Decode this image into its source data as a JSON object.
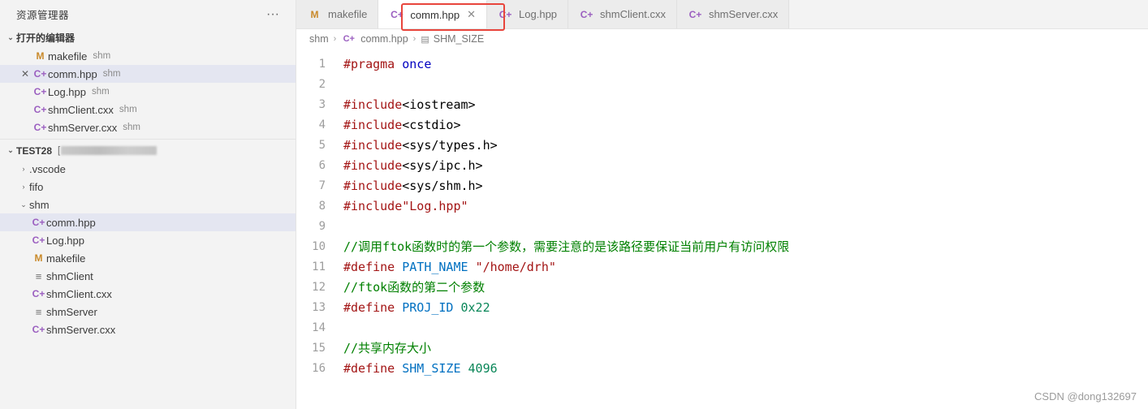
{
  "sidebar": {
    "title": "资源管理器",
    "more_icon": "ellipsis-icon",
    "open_editors": {
      "label": "打开的编辑器",
      "caret": "⌄",
      "items": [
        {
          "name": "makefile",
          "sub": "shm",
          "icon": "M",
          "icon_kind": "m",
          "closable": false,
          "selected": false
        },
        {
          "name": "comm.hpp",
          "sub": "shm",
          "icon": "C+",
          "icon_kind": "cpp",
          "closable": true,
          "selected": true
        },
        {
          "name": "Log.hpp",
          "sub": "shm",
          "icon": "C+",
          "icon_kind": "cpp",
          "closable": false,
          "selected": false
        },
        {
          "name": "shmClient.cxx",
          "sub": "shm",
          "icon": "C+",
          "icon_kind": "cpp",
          "closable": false,
          "selected": false
        },
        {
          "name": "shmServer.cxx",
          "sub": "shm",
          "icon": "C+",
          "icon_kind": "cpp",
          "closable": false,
          "selected": false
        }
      ]
    },
    "workspace": {
      "label": "TEST28",
      "bracket_open": "[",
      "blurred": true,
      "caret": "⌄",
      "folders": [
        {
          "name": ".vscode",
          "caret": "›"
        },
        {
          "name": "fifo",
          "caret": "›"
        },
        {
          "name": "shm",
          "caret": "⌄"
        }
      ],
      "files": [
        {
          "name": "comm.hpp",
          "icon": "C+",
          "icon_kind": "cpp",
          "selected": true
        },
        {
          "name": "Log.hpp",
          "icon": "C+",
          "icon_kind": "cpp",
          "selected": false
        },
        {
          "name": "makefile",
          "icon": "M",
          "icon_kind": "m",
          "selected": false
        },
        {
          "name": "shmClient",
          "icon": "≡",
          "icon_kind": "plain",
          "selected": false
        },
        {
          "name": "shmClient.cxx",
          "icon": "C+",
          "icon_kind": "cpp",
          "selected": false
        },
        {
          "name": "shmServer",
          "icon": "≡",
          "icon_kind": "plain",
          "selected": false
        },
        {
          "name": "shmServer.cxx",
          "icon": "C+",
          "icon_kind": "cpp",
          "selected": false
        }
      ]
    }
  },
  "tabs": [
    {
      "label": "makefile",
      "icon": "M",
      "icon_kind": "m",
      "active": false,
      "close": ""
    },
    {
      "label": "comm.hpp",
      "icon": "C+",
      "icon_kind": "cpp",
      "active": true,
      "close": "✕",
      "highlighted": true
    },
    {
      "label": "Log.hpp",
      "icon": "C+",
      "icon_kind": "cpp",
      "active": false,
      "close": ""
    },
    {
      "label": "shmClient.cxx",
      "icon": "C+",
      "icon_kind": "cpp",
      "active": false,
      "close": ""
    },
    {
      "label": "shmServer.cxx",
      "icon": "C+",
      "icon_kind": "cpp",
      "active": false,
      "close": ""
    }
  ],
  "breadcrumb": [
    {
      "label": "shm",
      "icon": ""
    },
    {
      "label": "comm.hpp",
      "icon": "C+"
    },
    {
      "label": "SHM_SIZE",
      "icon": "▤"
    }
  ],
  "code": {
    "lines": [
      {
        "n": "1",
        "parts": [
          {
            "t": "#pragma",
            "c": "k-pre"
          },
          {
            "t": " ",
            "c": ""
          },
          {
            "t": "once",
            "c": "k-dir"
          }
        ]
      },
      {
        "n": "2",
        "parts": []
      },
      {
        "n": "3",
        "parts": [
          {
            "t": "#include",
            "c": "k-pre"
          },
          {
            "t": "<iostream>",
            "c": "code-text"
          }
        ]
      },
      {
        "n": "4",
        "parts": [
          {
            "t": "#include",
            "c": "k-pre"
          },
          {
            "t": "<cstdio>",
            "c": "code-text"
          }
        ]
      },
      {
        "n": "5",
        "parts": [
          {
            "t": "#include",
            "c": "k-pre"
          },
          {
            "t": "<sys/types.h>",
            "c": "code-text"
          }
        ]
      },
      {
        "n": "6",
        "parts": [
          {
            "t": "#include",
            "c": "k-pre"
          },
          {
            "t": "<sys/ipc.h>",
            "c": "code-text"
          }
        ]
      },
      {
        "n": "7",
        "parts": [
          {
            "t": "#include",
            "c": "k-pre"
          },
          {
            "t": "<sys/shm.h>",
            "c": "code-text"
          }
        ]
      },
      {
        "n": "8",
        "parts": [
          {
            "t": "#include",
            "c": "k-pre"
          },
          {
            "t": "\"Log.hpp\"",
            "c": "k-str"
          }
        ]
      },
      {
        "n": "9",
        "parts": []
      },
      {
        "n": "10",
        "parts": [
          {
            "t": "//调用ftok函数时的第一个参数，需要注意的是该路径要保证当前用户有访问权限",
            "c": "k-com"
          }
        ]
      },
      {
        "n": "11",
        "parts": [
          {
            "t": "#define",
            "c": "k-pre"
          },
          {
            "t": " ",
            "c": ""
          },
          {
            "t": "PATH_NAME",
            "c": "k-macro"
          },
          {
            "t": " ",
            "c": ""
          },
          {
            "t": "\"/home/drh\"",
            "c": "k-str"
          }
        ]
      },
      {
        "n": "12",
        "parts": [
          {
            "t": "//ftok函数的第二个参数",
            "c": "k-com"
          }
        ]
      },
      {
        "n": "13",
        "parts": [
          {
            "t": "#define",
            "c": "k-pre"
          },
          {
            "t": " ",
            "c": ""
          },
          {
            "t": "PROJ_ID",
            "c": "k-macro"
          },
          {
            "t": " ",
            "c": ""
          },
          {
            "t": "0x22",
            "c": "k-num"
          }
        ]
      },
      {
        "n": "14",
        "parts": []
      },
      {
        "n": "15",
        "parts": [
          {
            "t": "//共享内存大小",
            "c": "k-com"
          }
        ]
      },
      {
        "n": "16",
        "parts": [
          {
            "t": "#define",
            "c": "k-pre"
          },
          {
            "t": " ",
            "c": ""
          },
          {
            "t": "SHM_SIZE",
            "c": "k-macro"
          },
          {
            "t": " ",
            "c": ""
          },
          {
            "t": "4096",
            "c": "k-num"
          }
        ]
      }
    ]
  },
  "watermark": "CSDN @dong132697",
  "colors": {
    "highlight": "#e8453c",
    "selected_row": "#e4e6f1",
    "sidebar_bg": "#f3f3f3",
    "cpp_icon": "#9b5fc0",
    "make_icon": "#c98a2b",
    "comment": "#008000",
    "preproc": "#a31515",
    "macro": "#0070c1",
    "number": "#098658"
  }
}
